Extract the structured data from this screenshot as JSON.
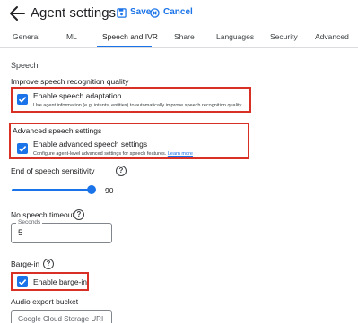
{
  "header": {
    "title": "Agent settings",
    "save_label": "Save",
    "cancel_label": "Cancel",
    "accent_color": "#1a73e8"
  },
  "tabs": [
    {
      "label": "General",
      "active": false
    },
    {
      "label": "ML",
      "active": false
    },
    {
      "label": "Speech and IVR",
      "active": true
    },
    {
      "label": "Share",
      "active": false
    },
    {
      "label": "Languages",
      "active": false
    },
    {
      "label": "Security",
      "active": false
    },
    {
      "label": "Advanced",
      "active": false
    }
  ],
  "speech": {
    "section_title": "Speech",
    "improve": {
      "heading": "Improve speech recognition quality",
      "option_label": "Enable speech adaptation",
      "option_description": "Use agent information (e.g. intents, entities) to automatically improve speech recognition quality.",
      "checked": true
    },
    "advanced": {
      "heading": "Advanced speech settings",
      "option_label": "Enable advanced speech settings",
      "option_description": "Configure agent-level advanced settings for speech features.",
      "link_text": "Learn more",
      "checked": true
    },
    "end_of_speech": {
      "label": "End of speech sensitivity",
      "value": "90",
      "level_percent": 90
    },
    "no_speech_timeout": {
      "label": "No speech timeout",
      "field_label": "Seconds",
      "value": "5"
    },
    "barge_in": {
      "label": "Barge-in",
      "option_label": "Enable barge-in",
      "checked": true
    },
    "audio_export": {
      "label": "Audio export bucket",
      "placeholder": "Google Cloud Storage URI"
    }
  },
  "highlight_color": "#d93025"
}
